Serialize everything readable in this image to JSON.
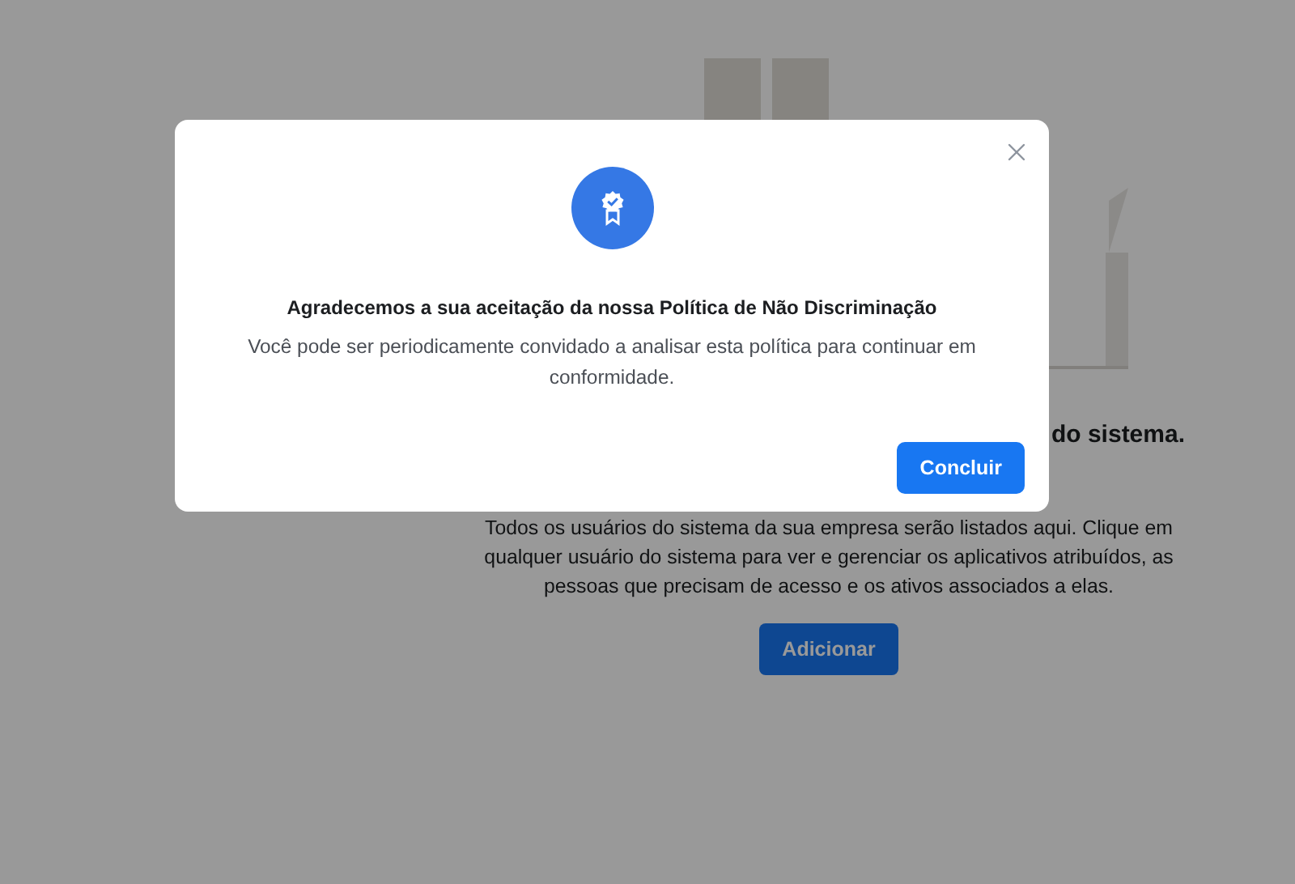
{
  "page": {
    "heading": "do sistema.",
    "description": "Todos os usuários do sistema da sua empresa serão listados aqui. Clique em qualquer usuário do sistema para ver e gerenciar os aplicativos atribuídos, as pessoas que precisam de acesso e os ativos associados a elas.",
    "add_button": "Adicionar"
  },
  "dialog": {
    "title": "Agradecemos a sua aceitação da nossa Política de Não Discriminação",
    "message": "Você pode ser periodicamente convidado a analisar esta política para continuar em conformidade.",
    "confirm_button": "Concluir"
  }
}
